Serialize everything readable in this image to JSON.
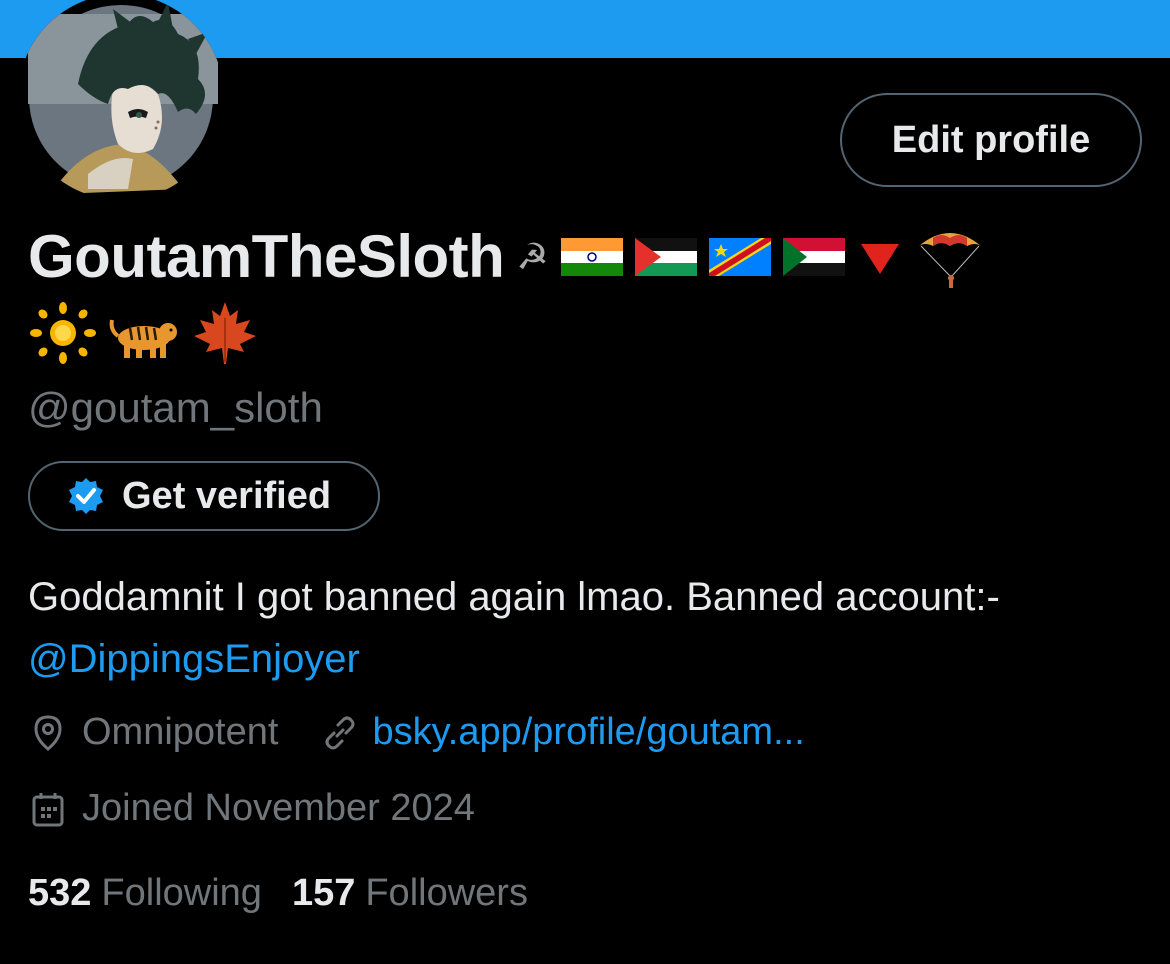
{
  "profile": {
    "display_name": "GoutamTheSloth",
    "name_emojis_line1": [
      "☭",
      "🇮🇳",
      "🇵🇸",
      "🇨🇩",
      "🇸🇩",
      "🔻",
      "🪂"
    ],
    "name_emojis_line2": [
      "🔆",
      "🐅",
      "🍁"
    ],
    "handle": "@goutam_sloth",
    "avatar_icon": "anime-avatar-icon"
  },
  "actions": {
    "edit_profile_label": "Edit profile",
    "get_verified_label": "Get verified"
  },
  "bio": {
    "text": "Goddamnit I got banned again lmao. Banned account:-",
    "mention": "@DippingsEnjoyer"
  },
  "meta": {
    "location": "Omnipotent",
    "location_icon": "location-pin-icon",
    "website": "bsky.app/profile/goutam...",
    "website_icon": "link-icon",
    "joined": "Joined November 2024",
    "joined_icon": "calendar-icon"
  },
  "stats": {
    "following_count": "532",
    "following_label": "Following",
    "followers_count": "157",
    "followers_label": "Followers"
  },
  "colors": {
    "banner": "#1d9bf0",
    "background": "#000000",
    "text_primary": "#e7e9ea",
    "text_secondary": "#71767b",
    "accent": "#1d9bf0",
    "border": "#536471"
  }
}
